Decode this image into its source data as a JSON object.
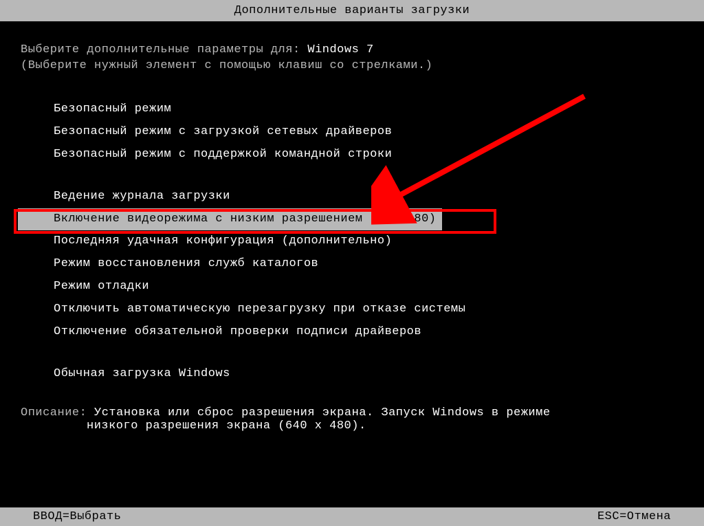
{
  "title": "Дополнительные варианты загрузки",
  "prompt": {
    "prefix": "Выберите дополнительные параметры для: ",
    "os": "Windows 7"
  },
  "hint": "(Выберите нужный элемент с помощью клавиш со стрелками.)",
  "menu": {
    "group1": [
      "Безопасный режим",
      "Безопасный режим с загрузкой сетевых драйверов",
      "Безопасный режим с поддержкой командной строки"
    ],
    "group2": [
      "Ведение журнала загрузки",
      "Включение видеорежима с низким разрешением (640x480)",
      "Последняя удачная конфигурация (дополнительно)",
      "Режим восстановления служб каталогов",
      "Режим отладки",
      "Отключить автоматическую перезагрузку при отказе системы",
      "Отключение обязательной проверки подписи драйверов"
    ],
    "group3": [
      "Обычная загрузка Windows"
    ],
    "selected_index": 1,
    "selected_group": 2
  },
  "description": {
    "label": "Описание: ",
    "text_line1": "Установка или сброс разрешения экрана. Запуск Windows в режиме",
    "text_line2": "низкого разрешения экрана (640 x 480)."
  },
  "footer": {
    "left": "ВВОД=Выбрать",
    "right": "ESC=Отмена"
  },
  "annotation": {
    "arrow_color": "#ff0000"
  }
}
